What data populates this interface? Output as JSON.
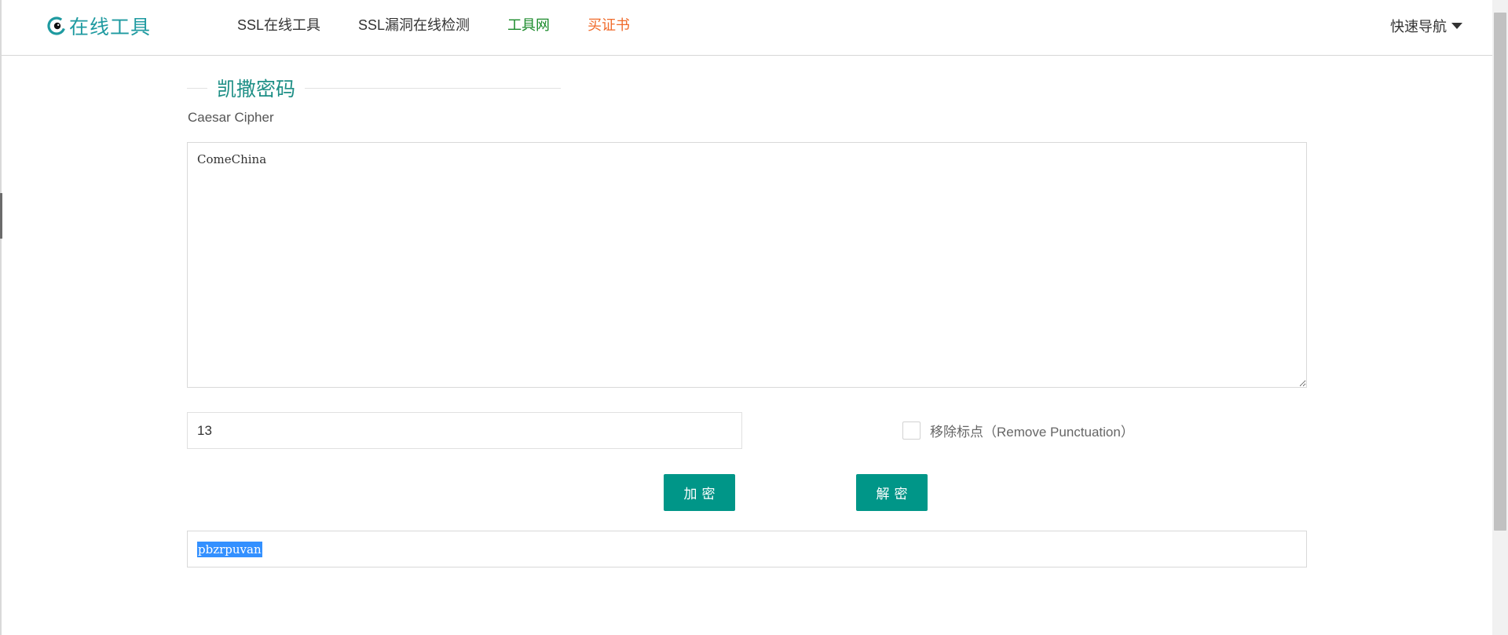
{
  "header": {
    "logo_text": "在线工具",
    "nav": [
      {
        "label": "SSL在线工具"
      },
      {
        "label": "SSL漏洞在线检测"
      },
      {
        "label": "工具网"
      },
      {
        "label": "买证书"
      }
    ],
    "quick_nav_label": "快速导航"
  },
  "tool": {
    "title": "凯撒密码",
    "subtitle": "Caesar Cipher",
    "input_text": "ComeChina",
    "shift_value": "13",
    "remove_punctuation_label": "移除标点（Remove Punctuation）",
    "remove_punctuation_checked": false,
    "encrypt_label": "加密",
    "decrypt_label": "解密",
    "result_text": "pbzrpuvan"
  },
  "colors": {
    "accent": "#009688",
    "logo": "#1e9aa0",
    "nav_green": "#1a8a2a",
    "nav_orange": "#f06a2a",
    "selection": "#3390ff"
  },
  "icons": {
    "logo": "eye-logo-icon",
    "quick_nav": "caret-down-icon"
  }
}
